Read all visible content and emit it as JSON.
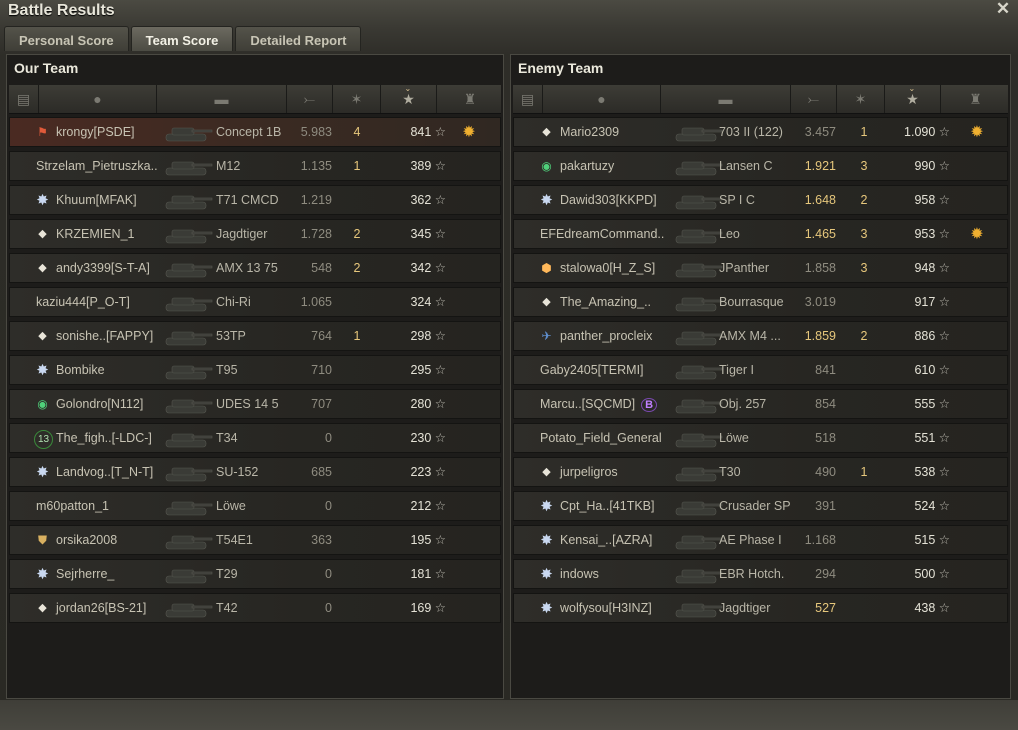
{
  "window": {
    "title": "Battle Results",
    "close": "✕"
  },
  "tabs": [
    {
      "label": "Personal Score",
      "active": false
    },
    {
      "label": "Team Score",
      "active": true
    },
    {
      "label": "Detailed Report",
      "active": false
    }
  ],
  "our_team": {
    "title": "Our Team",
    "players": [
      {
        "badge": "flag",
        "badge_glyph": "⚑",
        "name": "krongy[PSDE]",
        "tank": "Concept 1B",
        "damage": "5.983",
        "damage_hi": false,
        "kills": "4",
        "xp": "841",
        "medal": true,
        "me": true
      },
      {
        "badge": "",
        "badge_glyph": "",
        "name": "Strzelam_Pietruszka..",
        "tank": "M12",
        "damage": "1.135",
        "damage_hi": false,
        "kills": "1",
        "xp": "389",
        "medal": false
      },
      {
        "badge": "star",
        "badge_glyph": "✸",
        "name": "Khuum[MFAK]",
        "tank": "T71 CMCD",
        "damage": "1.219",
        "damage_hi": false,
        "kills": "",
        "xp": "362",
        "medal": false
      },
      {
        "badge": "diamond",
        "badge_glyph": "◆",
        "name": "KRZEMIEN_1",
        "tank": "Jagdtiger",
        "damage": "1.728",
        "damage_hi": false,
        "kills": "2",
        "xp": "345",
        "medal": false
      },
      {
        "badge": "diamond",
        "badge_glyph": "◆",
        "name": "andy3399[S-T-A]",
        "tank": "AMX 13 75",
        "damage": "548",
        "damage_hi": false,
        "kills": "2",
        "xp": "342",
        "medal": false
      },
      {
        "badge": "",
        "badge_glyph": "",
        "name": "kaziu444[P_O-T]",
        "tank": "Chi-Ri",
        "damage": "1.065",
        "damage_hi": false,
        "kills": "",
        "xp": "324",
        "medal": false
      },
      {
        "badge": "diamond",
        "badge_glyph": "◆",
        "name": "sonishe..[FAPPY]",
        "tank": "53TP",
        "damage": "764",
        "damage_hi": false,
        "kills": "1",
        "xp": "298",
        "medal": false
      },
      {
        "badge": "star",
        "badge_glyph": "✸",
        "name": "Bombike",
        "tank": "T95",
        "damage": "710",
        "damage_hi": false,
        "kills": "",
        "xp": "295",
        "medal": false
      },
      {
        "badge": "green",
        "badge_glyph": "◉",
        "name": "Golondro[N112]",
        "tank": "UDES 14 5",
        "damage": "707",
        "damage_hi": false,
        "kills": "",
        "xp": "280",
        "medal": false
      },
      {
        "badge": "num",
        "badge_glyph": "13",
        "name": "The_figh..[-LDC-]",
        "tank": "T34",
        "damage": "0",
        "damage_hi": false,
        "kills": "",
        "xp": "230",
        "medal": false
      },
      {
        "badge": "star",
        "badge_glyph": "✸",
        "name": "Landvog..[T_N-T]",
        "tank": "SU-152",
        "damage": "685",
        "damage_hi": false,
        "kills": "",
        "xp": "223",
        "medal": false
      },
      {
        "badge": "",
        "badge_glyph": "",
        "name": "m60patton_1",
        "tank": "Löwe",
        "damage": "0",
        "damage_hi": false,
        "kills": "",
        "xp": "212",
        "medal": false
      },
      {
        "badge": "shield",
        "badge_glyph": "⛊",
        "name": "orsika2008",
        "tank": "T54E1",
        "damage": "363",
        "damage_hi": false,
        "kills": "",
        "xp": "195",
        "medal": false
      },
      {
        "badge": "star",
        "badge_glyph": "✸",
        "name": "Sejrherre_",
        "tank": "T29",
        "damage": "0",
        "damage_hi": false,
        "kills": "",
        "xp": "181",
        "medal": false
      },
      {
        "badge": "diamond",
        "badge_glyph": "◆",
        "name": "jordan26[BS-21]",
        "tank": "T42",
        "damage": "0",
        "damage_hi": false,
        "kills": "",
        "xp": "169",
        "medal": false
      }
    ]
  },
  "enemy_team": {
    "title": "Enemy Team",
    "players": [
      {
        "badge": "diamond",
        "badge_glyph": "◆",
        "name": "Mario2309",
        "tank": "703 II (122)",
        "damage": "3.457",
        "damage_hi": false,
        "kills": "1",
        "xp": "1.090",
        "medal": true
      },
      {
        "badge": "green",
        "badge_glyph": "◉",
        "name": "pakartuzy",
        "tank": "Lansen C",
        "damage": "1.921",
        "damage_hi": true,
        "kills": "3",
        "xp": "990",
        "medal": false
      },
      {
        "badge": "star",
        "badge_glyph": "✸",
        "name": "Dawid303[KKPD]",
        "tank": "SP I C",
        "damage": "1.648",
        "damage_hi": true,
        "kills": "2",
        "xp": "958",
        "medal": false
      },
      {
        "badge": "",
        "badge_glyph": "",
        "name": "EFEdreamCommand..",
        "tank": "Leo",
        "damage": "1.465",
        "damage_hi": true,
        "kills": "3",
        "xp": "953",
        "medal": true
      },
      {
        "badge": "hex",
        "badge_glyph": "⬢",
        "name": "stalowa0[H_Z_S]",
        "tank": "JPanther",
        "damage": "1.858",
        "damage_hi": false,
        "kills": "3",
        "xp": "948",
        "medal": false
      },
      {
        "badge": "diamond",
        "badge_glyph": "◆",
        "name": "The_Amazing_..",
        "tank": "Bourrasque",
        "damage": "3.019",
        "damage_hi": false,
        "kills": "",
        "xp": "917",
        "medal": false
      },
      {
        "badge": "plane",
        "badge_glyph": "✈",
        "name": "panther_procleix",
        "tank": "AMX M4 ...",
        "damage": "1.859",
        "damage_hi": true,
        "kills": "2",
        "xp": "886",
        "medal": false
      },
      {
        "badge": "",
        "badge_glyph": "",
        "name": "Gaby2405[TERMI]",
        "tank": "Tiger I",
        "damage": "841",
        "damage_hi": false,
        "kills": "",
        "xp": "610",
        "medal": false
      },
      {
        "badge": "",
        "badge_glyph": "",
        "name": "Marcu..[SQCMD]",
        "clan_badge": "B",
        "tank": "Obj. 257",
        "damage": "854",
        "damage_hi": false,
        "kills": "",
        "xp": "555",
        "medal": false
      },
      {
        "badge": "",
        "badge_glyph": "",
        "name": "Potato_Field_General",
        "tank": "Löwe",
        "damage": "518",
        "damage_hi": false,
        "kills": "",
        "xp": "551",
        "medal": false
      },
      {
        "badge": "diamond",
        "badge_glyph": "◆",
        "name": "jurpeligros",
        "tank": "T30",
        "damage": "490",
        "damage_hi": false,
        "kills": "1",
        "xp": "538",
        "medal": false
      },
      {
        "badge": "star",
        "badge_glyph": "✸",
        "name": "Cpt_Ha..[41TKB]",
        "tank": "Crusader SP",
        "damage": "391",
        "damage_hi": false,
        "kills": "",
        "xp": "524",
        "medal": false
      },
      {
        "badge": "star",
        "badge_glyph": "✸",
        "name": "Kensai_..[AZRA]",
        "tank": "AE Phase I",
        "damage": "1.168",
        "damage_hi": false,
        "kills": "",
        "xp": "515",
        "medal": false
      },
      {
        "badge": "star",
        "badge_glyph": "✸",
        "name": "indows",
        "tank": "EBR Hotch.",
        "damage": "294",
        "damage_hi": false,
        "kills": "",
        "xp": "500",
        "medal": false
      },
      {
        "badge": "star",
        "badge_glyph": "✸",
        "name": "wolfysou[H3INZ]",
        "tank": "Jagdtiger",
        "damage": "527",
        "damage_hi": true,
        "kills": "",
        "xp": "438",
        "medal": false
      }
    ]
  },
  "icons": {
    "xp_star": "☆",
    "medal": "✹",
    "sort": "⌄"
  },
  "colors": {
    "highlight_row": "#4a2a22",
    "damage_highlight": "#e6c77c",
    "medal": "#f0b030"
  }
}
